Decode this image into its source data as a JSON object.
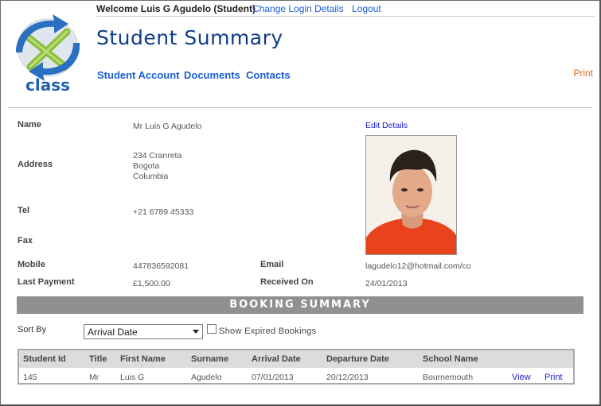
{
  "app": {
    "logo_text": "class"
  },
  "topbar": {
    "welcome": "Welcome Luis G Agudelo (Student)",
    "change_login": "Change Login Details",
    "logout": "Logout"
  },
  "page": {
    "title": "Student Summary",
    "print_label": "Print"
  },
  "nav": {
    "items": [
      {
        "label": "Student Account"
      },
      {
        "label": "Documents"
      },
      {
        "label": "Contacts"
      }
    ]
  },
  "details": {
    "name_label": "Name",
    "name_value": "Mr Luis G Agudelo",
    "address_label": "Address",
    "address_lines": [
      "234 Cranreta",
      "Bogota",
      "Columbia"
    ],
    "tel_label": "Tel",
    "tel_value": "+21 6789 45333",
    "fax_label": "Fax",
    "mobile_label": "Mobile",
    "mobile_value": "447836592081",
    "email_label": "Email",
    "email_value": "lagudelo12@hotmail.com/co",
    "last_payment_label": "Last Payment",
    "last_payment_value": "£1,500.00",
    "received_on_label": "Received On",
    "received_on_value": "24/01/2013",
    "edit_details": "Edit Details"
  },
  "booking_summary": {
    "title": "BOOKING SUMMARY",
    "sort_label": "Sort By",
    "sort_selected": "Arrival Date",
    "show_expired_label": "Show Expired Bookings",
    "show_expired_checked": false,
    "columns": [
      "Student Id",
      "Title",
      "First Name",
      "Surname",
      "Arrival Date",
      "Departure Date",
      "School Name"
    ],
    "rows": [
      {
        "student_id": "145",
        "title": "Mr",
        "first_name": "Luis G",
        "surname": "Agudelo",
        "arrival_date": "07/01/2013",
        "departure_date": "20/12/2013",
        "school_name": "Bournemouth",
        "view_label": "View",
        "print_label": "Print"
      }
    ]
  },
  "colors": {
    "link": "#1a5fd4",
    "title": "#0d3c8a",
    "print_accent": "#d2691e",
    "section_bar": "#909090"
  }
}
